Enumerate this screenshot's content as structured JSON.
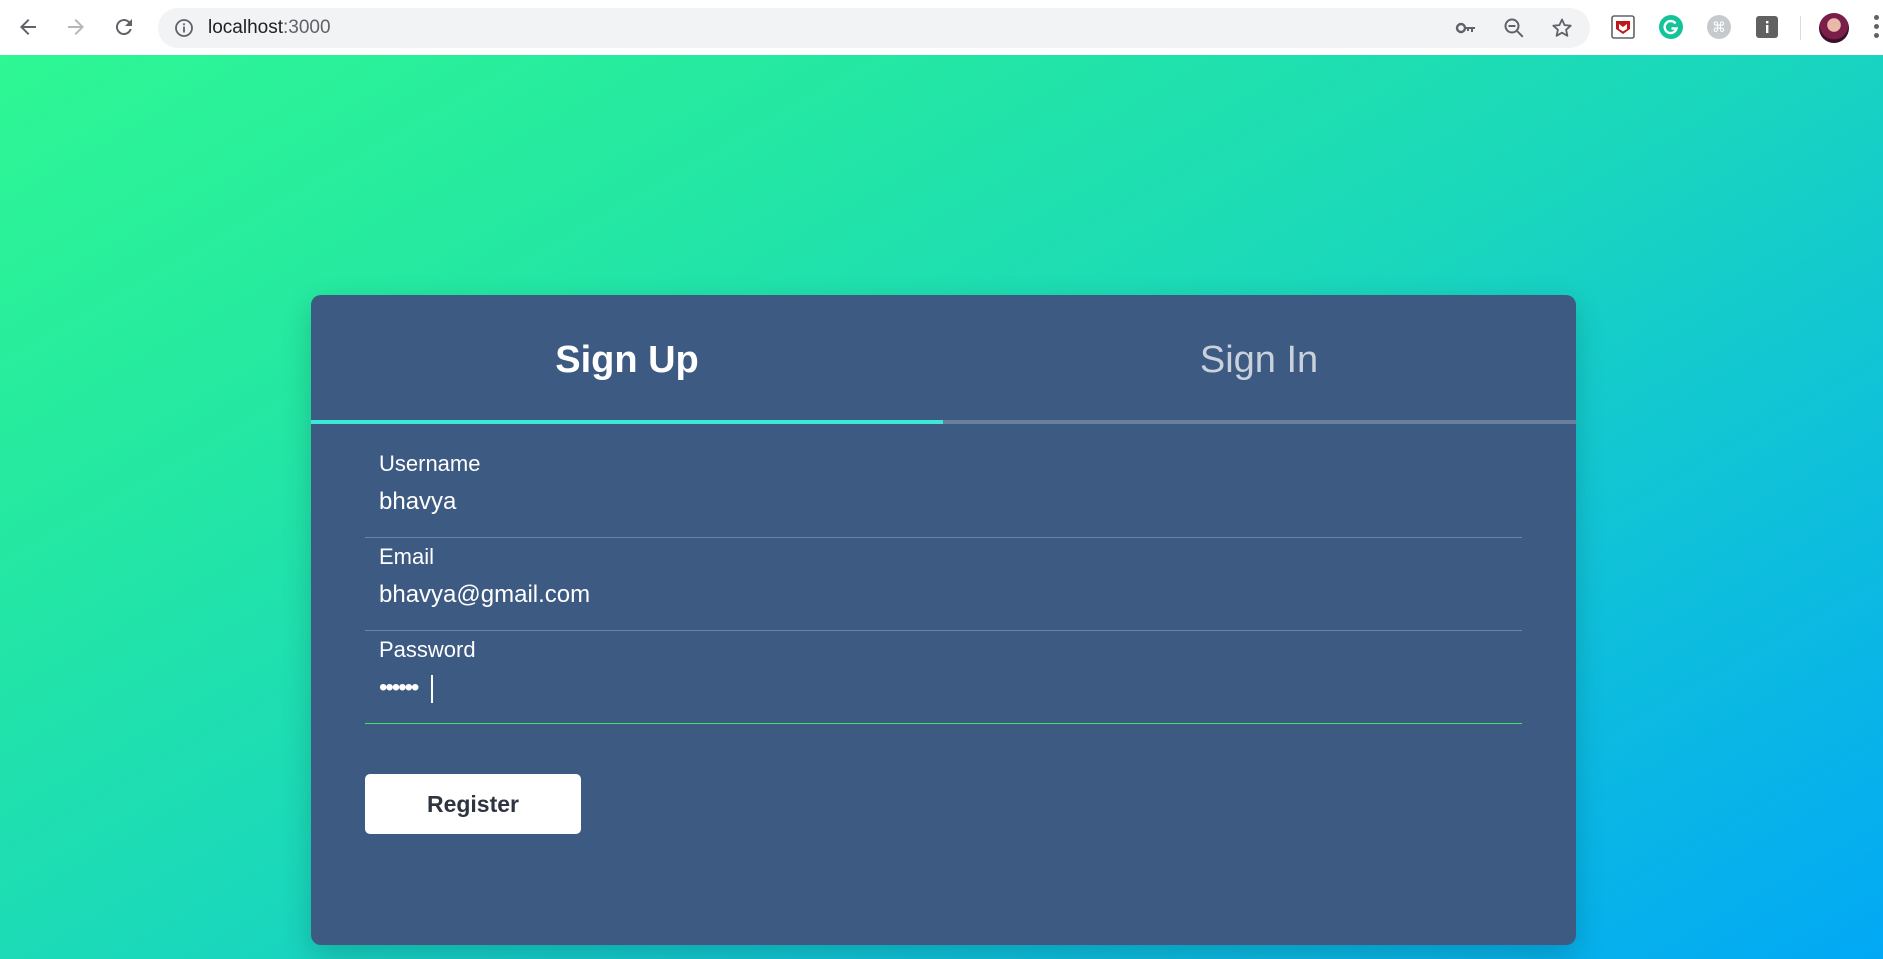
{
  "browser": {
    "url_host": "localhost",
    "url_port": ":3000",
    "icons": {
      "back": "arrow-left-icon",
      "forward": "arrow-right-icon",
      "reload": "reload-icon",
      "site_info": "info-icon",
      "key": "key-icon",
      "zoom": "zoom-out-icon",
      "bookmark": "star-icon"
    },
    "extensions": [
      {
        "name": "mcafee-extension-icon",
        "color": "#c01818"
      },
      {
        "name": "grammarly-extension-icon",
        "color": "#15c39a"
      },
      {
        "name": "command-extension-icon",
        "color": "#9aa0a6"
      },
      {
        "name": "info-extension-icon",
        "color": "#616161"
      }
    ]
  },
  "auth_card": {
    "tabs": [
      {
        "label": "Sign Up",
        "active": true
      },
      {
        "label": "Sign In",
        "active": false
      }
    ],
    "fields": {
      "username": {
        "label": "Username",
        "value": "bhavya"
      },
      "email": {
        "label": "Email",
        "value": "bhavya@gmail.com"
      },
      "password": {
        "label": "Password",
        "value": "••••••"
      }
    },
    "submit_label": "Register"
  },
  "colors": {
    "card_bg": "#3d5a82",
    "tab_indicator": "#3ee8d8",
    "focus_underline": "#48e06a",
    "gradient_start": "#2ef794",
    "gradient_end": "#02a8f5"
  }
}
